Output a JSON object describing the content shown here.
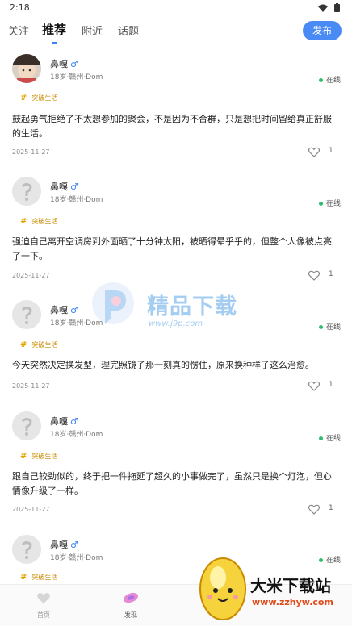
{
  "status_bar": {
    "time": "2:18"
  },
  "tabs": [
    {
      "label": "关注"
    },
    {
      "label": "推荐"
    },
    {
      "label": "附近"
    },
    {
      "label": "话题"
    }
  ],
  "publish_label": "发布",
  "posts": [
    {
      "username": "鼻嘎",
      "gender": "♂",
      "meta": "18岁·赣州·Dom",
      "online": "在线",
      "tag": "突破生活",
      "content": "鼓起勇气拒绝了不太想参加的聚会，不是因为不合群，只是想把时间留给真正舒服的生活。",
      "date": "2025-11-27",
      "likes": "1"
    },
    {
      "username": "鼻嘎",
      "gender": "♂",
      "meta": "18岁·赣州·Dom",
      "online": "在线",
      "tag": "突破生活",
      "content": "强迫自己离开空调房到外面晒了十分钟太阳，被晒得晕乎乎的，但整个人像被点亮了一下。",
      "date": "2025-11-27",
      "likes": "1"
    },
    {
      "username": "鼻嘎",
      "gender": "♂",
      "meta": "18岁·赣州·Dom",
      "online": "在线",
      "tag": "突破生活",
      "content": "今天突然决定换发型，理完照镜子那一刻真的愣住，原来换种样子这么治愈。",
      "date": "2025-11-27",
      "likes": "1"
    },
    {
      "username": "鼻嘎",
      "gender": "♂",
      "meta": "18岁·赣州·Dom",
      "online": "在线",
      "tag": "突破生活",
      "content": "跟自己较劲似的，终于把一件拖延了超久的小事做完了，虽然只是换个灯泡，但心情像升级了一样。",
      "date": "2025-11-27",
      "likes": "1"
    },
    {
      "username": "鼻嘎",
      "gender": "♂",
      "meta": "18岁·赣州·Dom",
      "online": "在线",
      "tag": "突破生活",
      "content": "",
      "date": "",
      "likes": ""
    }
  ],
  "watermark": {
    "text": "精品下载",
    "url": "www.j9p.com"
  },
  "bottom_nav": [
    {
      "label": "首页"
    },
    {
      "label": "发现"
    }
  ],
  "corner_logo": {
    "text": "大米下载站",
    "url": "www.zzhyw.com"
  },
  "colors": {
    "accent": "#4a8af4",
    "online": "#2ebd6b",
    "tag": "#e3a500"
  }
}
